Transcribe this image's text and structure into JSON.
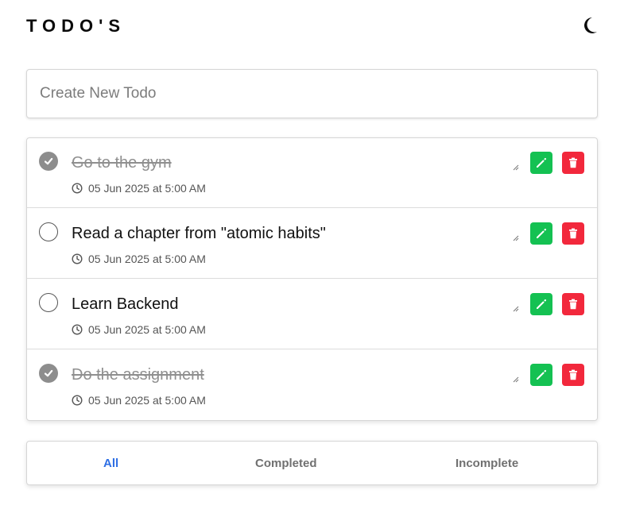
{
  "header": {
    "title": "TODO'S",
    "theme_icon": "moon-icon"
  },
  "create": {
    "placeholder": "Create New Todo",
    "value": ""
  },
  "todos": [
    {
      "text": "Go to the gym",
      "time": "05 Jun 2025 at 5:00 AM",
      "completed": true
    },
    {
      "text": "Read a chapter from \"atomic habits\"",
      "time": "05 Jun 2025 at 5:00 AM",
      "completed": false
    },
    {
      "text": "Learn Backend",
      "time": "05 Jun 2025 at 5:00 AM",
      "completed": false
    },
    {
      "text": "Do the assignment",
      "time": "05 Jun 2025 at 5:00 AM",
      "completed": true
    }
  ],
  "filters": {
    "all": "All",
    "completed": "Completed",
    "incomplete": "Incomplete",
    "active": "All"
  },
  "colors": {
    "edit": "#14c152",
    "delete": "#f2283c",
    "active_filter": "#2f6fe4",
    "checked": "#8d8d8d"
  },
  "icons": {
    "check": "check-icon",
    "clock": "clock-icon",
    "edit": "pencil-icon",
    "delete": "trash-icon",
    "resize": "resize-handle-icon"
  }
}
